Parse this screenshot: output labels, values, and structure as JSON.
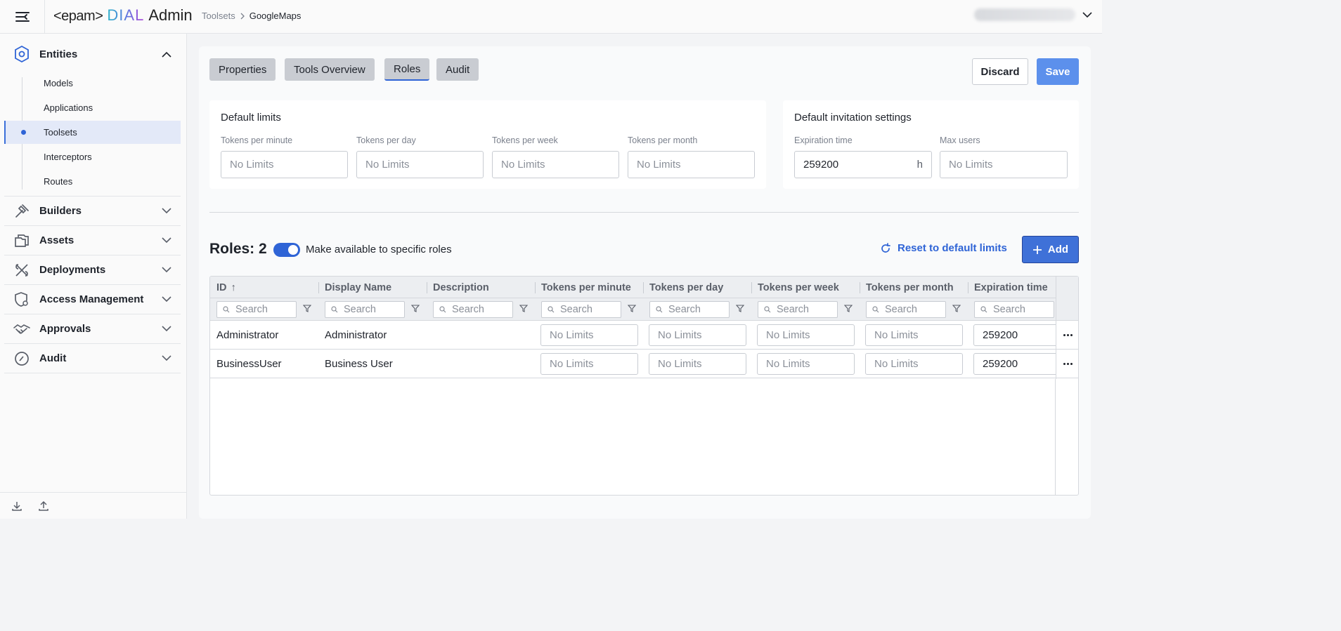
{
  "header": {
    "logo": {
      "epam": "<epam>",
      "dial": "DIAL",
      "admin": "Admin"
    },
    "breadcrumb": {
      "parent": "Toolsets",
      "current": "GoogleMaps"
    }
  },
  "sidebar": {
    "entities": {
      "label": "Entities",
      "items": [
        {
          "label": "Models"
        },
        {
          "label": "Applications"
        },
        {
          "label": "Toolsets"
        },
        {
          "label": "Interceptors"
        },
        {
          "label": "Routes"
        }
      ]
    },
    "sections": [
      {
        "label": "Builders"
      },
      {
        "label": "Assets"
      },
      {
        "label": "Deployments"
      },
      {
        "label": "Access Management"
      },
      {
        "label": "Approvals"
      },
      {
        "label": "Audit"
      }
    ]
  },
  "tabs": [
    {
      "label": "Properties"
    },
    {
      "label": "Tools Overview"
    },
    {
      "label": "Roles"
    },
    {
      "label": "Audit"
    }
  ],
  "actions": {
    "discard": "Discard",
    "save": "Save"
  },
  "default_limits": {
    "title": "Default limits",
    "fields": [
      {
        "label": "Tokens per minute",
        "placeholder": "No Limits"
      },
      {
        "label": "Tokens per day",
        "placeholder": "No Limits"
      },
      {
        "label": "Tokens per week",
        "placeholder": "No Limits"
      },
      {
        "label": "Tokens per month",
        "placeholder": "No Limits"
      }
    ]
  },
  "invitation": {
    "title": "Default invitation settings",
    "expiration": {
      "label": "Expiration time",
      "value": "259200",
      "suffix": "h"
    },
    "max_users": {
      "label": "Max users",
      "placeholder": "No Limits"
    }
  },
  "roles": {
    "title": "Roles: 2",
    "toggle_label": "Make available to specific roles",
    "reset_label": "Reset to default limits",
    "add_label": "Add"
  },
  "grid": {
    "columns": [
      {
        "label": "ID",
        "sort": "↑"
      },
      {
        "label": "Display Name"
      },
      {
        "label": "Description"
      },
      {
        "label": "Tokens per minute"
      },
      {
        "label": "Tokens per day"
      },
      {
        "label": "Tokens per week"
      },
      {
        "label": "Tokens per month"
      },
      {
        "label": "Expiration time"
      }
    ],
    "search_placeholder": "Search",
    "rows": [
      {
        "id": "Administrator",
        "display_name": "Administrator",
        "description": "",
        "tpm": "No Limits",
        "tpd": "No Limits",
        "tpw": "No Limits",
        "tpmo": "No Limits",
        "expiration": "259200"
      },
      {
        "id": "BusinessUser",
        "display_name": "Business User",
        "description": "",
        "tpm": "No Limits",
        "tpd": "No Limits",
        "tpw": "No Limits",
        "tpmo": "No Limits",
        "expiration": "259200"
      }
    ]
  },
  "colors": {
    "accent": "#2f64d6",
    "save": "#5c90ec",
    "add": "#3f71d8"
  },
  "icons": [
    "menu-icon",
    "chevron-down-icon",
    "entities-icon",
    "builders-icon",
    "assets-icon",
    "deployments-icon",
    "access-management-icon",
    "approvals-icon",
    "audit-icon",
    "download-icon",
    "upload-icon",
    "reload-icon",
    "plus-icon",
    "search-icon",
    "filter-icon",
    "more-icon"
  ]
}
